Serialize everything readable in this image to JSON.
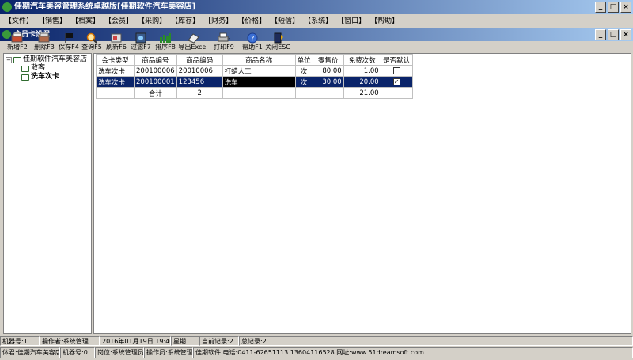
{
  "window": {
    "title": "佳期汽车美容管理系统卓越版[佳期软件汽车美容店]"
  },
  "menu": [
    "【文件】",
    "【销售】",
    "【档案】",
    "【会员】",
    "【采购】",
    "【库存】",
    "【财务】",
    "【价格】",
    "【短信】",
    "【系统】",
    "【窗口】",
    "【帮助】"
  ],
  "child": {
    "title": "会员卡设置"
  },
  "toolbar": [
    {
      "label": "新增F2",
      "icon": "add-card-icon"
    },
    {
      "label": "删除F3",
      "icon": "delete-card-icon"
    },
    {
      "label": "保存F4",
      "icon": "save-flag-icon"
    },
    {
      "label": "查询F5",
      "icon": "search-icon"
    },
    {
      "label": "刷新F6",
      "icon": "refresh-icon"
    },
    {
      "label": "过滤F7",
      "icon": "filter-icon"
    },
    {
      "label": "排序F8",
      "icon": "sort-icon"
    },
    {
      "label": "导出Excel",
      "icon": "excel-export-icon"
    },
    {
      "label": "打印F9",
      "icon": "printer-icon"
    },
    {
      "label": "帮助F1",
      "icon": "help-icon"
    },
    {
      "label": "关闭ESC",
      "icon": "close-door-icon"
    }
  ],
  "tree": {
    "root": "佳期软件汽车美容店",
    "children": [
      "散客",
      "洗车次卡"
    ]
  },
  "table": {
    "headers": [
      "会卡类型",
      "商品编号",
      "商品编码",
      "商品名称",
      "单位",
      "零售价",
      "免费次数",
      "是否默认"
    ],
    "rows": [
      {
        "type": "洗车次卡",
        "code": "200100006",
        "barcode": "20010006",
        "name": "打蜡人工",
        "unit": "次",
        "price": "80.00",
        "free": "1.00",
        "default": false
      },
      {
        "type": "洗车次卡",
        "code": "200100001",
        "barcode": "123456",
        "name": "洗车",
        "unit": "次",
        "price": "30.00",
        "free": "20.00",
        "default": true
      }
    ],
    "total": {
      "label": "合计",
      "count": "2",
      "free": "21.00"
    }
  },
  "status": {
    "machine": "机器号:1",
    "operator": "操作者:系统管理",
    "datetime": "2016年01月19日 19:40:13",
    "weekday": "星期二",
    "current": "当前记录:2",
    "total": "总记录:2"
  },
  "footer": {
    "store": "体君:佳期汽车美容店",
    "machine": "机器号:0",
    "post": "岗位:系统管理员",
    "operator": "操作员:系统管理",
    "contact": "佳期软件 电话:0411-62651113 13604116528 网址:www.51dreamsoft.com"
  }
}
